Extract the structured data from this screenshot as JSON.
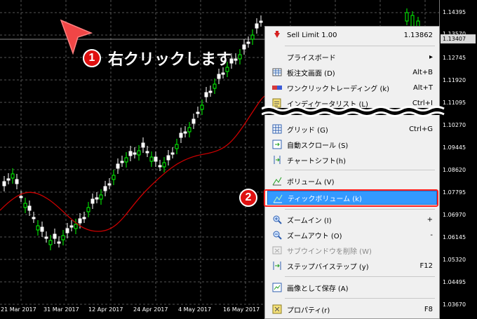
{
  "chart_data": {
    "type": "candlestick",
    "y_ticks": [
      "1.14395",
      "1.13570",
      "1.13407",
      "1.12745",
      "1.11920",
      "1.11095",
      "1.10270",
      "1.09445",
      "1.08620",
      "1.07795",
      "1.06970",
      "1.06145",
      "1.05320",
      "1.04495",
      "1.03670"
    ],
    "y_current_price": "1.13407",
    "x_ticks": [
      "21 Mar 2017",
      "31 Mar 2017",
      "12 Apr 2017",
      "24 Apr 2017",
      "4 May 2017",
      "16 May 2017"
    ],
    "grid": true,
    "moving_average_color": "#cc0000",
    "bull_color": "#00ff00",
    "bear_color": "#ffffff"
  },
  "annotations": {
    "step1_number": "1",
    "step1_text": "右クリックします",
    "step2_number": "2"
  },
  "menu": {
    "items": [
      {
        "label": "Sell Limit 1.00",
        "shortcut": "1.13862",
        "icon": "sell-limit-icon",
        "disabled": false
      },
      {
        "label": "プライスボード",
        "shortcut": "▸",
        "icon": "",
        "disabled": false
      },
      {
        "label": "板注文画面 (D)",
        "shortcut": "Alt+B",
        "icon": "order-book-icon",
        "disabled": false
      },
      {
        "label": "ワンクリックトレーディング (k)",
        "shortcut": "Alt+T",
        "icon": "one-click-trading-icon",
        "disabled": false
      },
      {
        "label": "インディケータリスト (L)",
        "shortcut": "Ctrl+I",
        "icon": "indicator-list-icon",
        "disabled": false
      },
      {
        "label": "グリッド (G)",
        "shortcut": "Ctrl+G",
        "icon": "grid-icon",
        "disabled": false
      },
      {
        "label": "自動スクロール (S)",
        "shortcut": "",
        "icon": "auto-scroll-icon",
        "disabled": false
      },
      {
        "label": "チャートシフト(h)",
        "shortcut": "",
        "icon": "chart-shift-icon",
        "disabled": false
      },
      {
        "label": "ボリューム (V)",
        "shortcut": "",
        "icon": "volume-icon",
        "disabled": false
      },
      {
        "label": "ティックボリューム (k)",
        "shortcut": "",
        "icon": "tick-volume-icon",
        "disabled": false
      },
      {
        "label": "ズームイン (I)",
        "shortcut": "+",
        "icon": "zoom-in-icon",
        "disabled": false
      },
      {
        "label": "ズームアウト (O)",
        "shortcut": "-",
        "icon": "zoom-out-icon",
        "disabled": false
      },
      {
        "label": "サブウインドウを削除 (W)",
        "shortcut": "",
        "icon": "delete-subwindow-icon",
        "disabled": true
      },
      {
        "label": "ステップバイステップ (y)",
        "shortcut": "F12",
        "icon": "step-by-step-icon",
        "disabled": false
      },
      {
        "label": "画像として保存 (A)",
        "shortcut": "",
        "icon": "save-image-icon",
        "disabled": false
      },
      {
        "label": "プロパティ(r)",
        "shortcut": "F8",
        "icon": "properties-icon",
        "disabled": false
      }
    ]
  }
}
